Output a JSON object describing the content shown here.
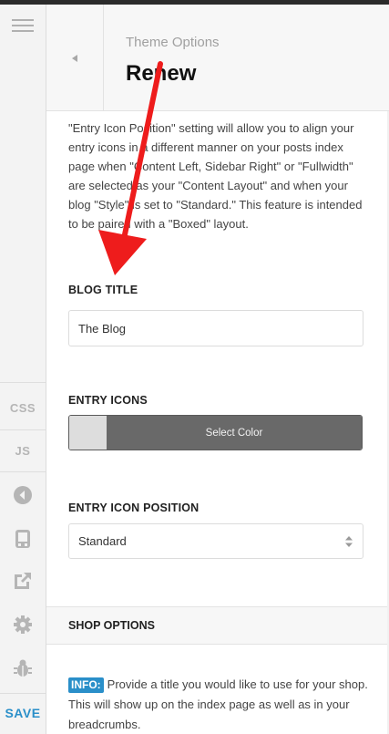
{
  "header": {
    "subtitle": "Theme Options",
    "title": "Renew"
  },
  "rail": {
    "items": [
      {
        "name": "menu-icon"
      },
      {
        "label": "CSS"
      },
      {
        "label": "JS"
      },
      {
        "name": "collapse-icon"
      },
      {
        "name": "device-preview-icon"
      },
      {
        "name": "external-link-icon"
      },
      {
        "name": "gear-icon"
      },
      {
        "name": "bug-icon"
      }
    ],
    "save_label": "SAVE"
  },
  "content": {
    "description": "\"Entry Icon Position\" setting will allow you to align your entry icons in a different manner on your posts index page when \"Content Left, Sidebar Right\" or \"Fullwidth\" are selected as your \"Content Layout\" and when your blog \"Style\" is set to \"Standard.\" This feature is intended to be paired with a \"Boxed\" layout.",
    "blog_title_label": "BLOG TITLE",
    "blog_title_value": "The Blog",
    "entry_icons_label": "ENTRY ICONS",
    "select_color_label": "Select Color",
    "entry_icon_position_label": "ENTRY ICON POSITION",
    "entry_icon_position_value": "Standard",
    "shop_options_label": "SHOP OPTIONS",
    "info_badge": "INFO:",
    "info_text": "Provide a title you would like to use for your shop. This will show up on the index page as well as in your breadcrumbs."
  },
  "colors": {
    "accent": "#2a8fc9",
    "annotation_arrow": "#ee1c1c",
    "color_button": "#696969",
    "swatch": "#dddddd"
  }
}
